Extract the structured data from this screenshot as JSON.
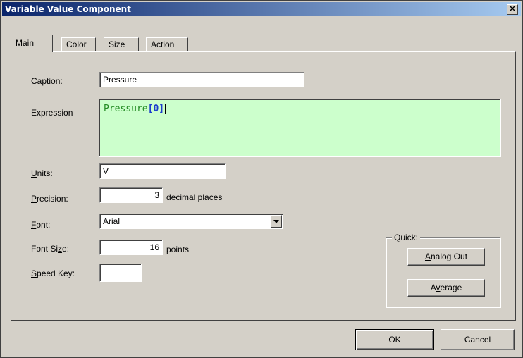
{
  "window": {
    "title": "Variable Value Component",
    "close_glyph": "✕"
  },
  "tabs": [
    {
      "label": "Main",
      "active": true
    },
    {
      "label": "Color",
      "active": false
    },
    {
      "label": "Size",
      "active": false
    },
    {
      "label": "Action",
      "active": false
    }
  ],
  "form": {
    "caption": {
      "label_u": "C",
      "label_rest": "aption:",
      "value": "Pressure"
    },
    "expression": {
      "label": "Expression",
      "var": "Pressure",
      "bracket_open": "[",
      "index": "0",
      "bracket_close": "]",
      "bg_color": "#ccffcc"
    },
    "units": {
      "label_u": "U",
      "label_rest": "nits:",
      "value": "V"
    },
    "precision": {
      "label_u": "P",
      "label_rest": "recision:",
      "value": "3",
      "suffix": "decimal places"
    },
    "font": {
      "label_u": "F",
      "label_rest": "ont:",
      "value": "Arial"
    },
    "font_size": {
      "label_pre": "Font Si",
      "label_u": "z",
      "label_rest": "e:",
      "value": "16",
      "suffix": "points"
    },
    "speed_key": {
      "label_u": "S",
      "label_rest": "peed Key:",
      "value": ""
    }
  },
  "quick": {
    "legend": "Quick:",
    "analog_out": {
      "u": "A",
      "rest": "nalog Out"
    },
    "average": {
      "pre": "A",
      "u": "v",
      "rest": "erage"
    }
  },
  "buttons": {
    "ok": "OK",
    "cancel": "Cancel"
  },
  "colors": {
    "title_start": "#0a246a",
    "title_end": "#a6caf0",
    "dialog_bg": "#d4d0c8"
  }
}
